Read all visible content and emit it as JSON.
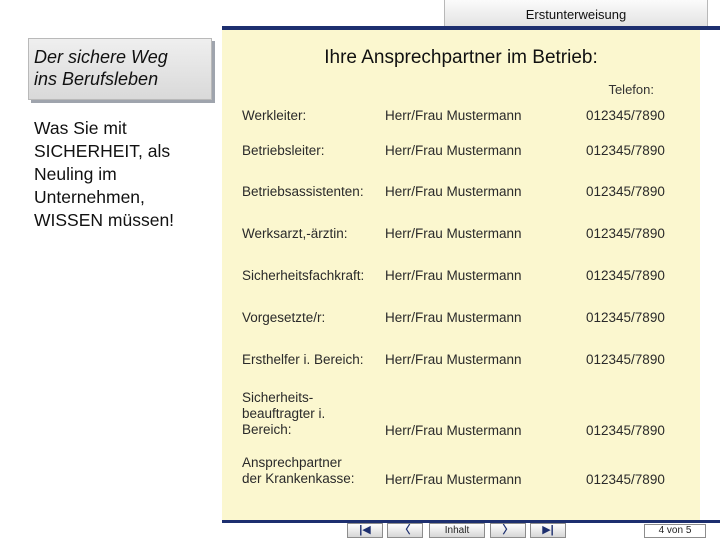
{
  "header": {
    "tab_label": "Erstunterweisung"
  },
  "left": {
    "title_lines": [
      "Der sichere Weg",
      "ins Berufsleben"
    ],
    "body_lines": [
      "Was Sie mit",
      "SICHERHEIT, als",
      "Neuling im",
      "Unternehmen,",
      "WISSEN müssen!"
    ]
  },
  "main": {
    "title": "Ihre Ansprechpartner im Betrieb:",
    "phone_header": "Telefon:",
    "contacts": [
      {
        "role_lines": [
          "Werkleiter:"
        ],
        "name": "Herr/Frau Mustermann",
        "phone": "012345/7890"
      },
      {
        "role_lines": [
          "Betriebsleiter:"
        ],
        "name": "Herr/Frau Mustermann",
        "phone": "012345/7890"
      },
      {
        "role_lines": [
          "Betriebsassistenten:"
        ],
        "name": "Herr/Frau Mustermann",
        "phone": "012345/7890"
      },
      {
        "role_lines": [
          "Werksarzt,-ärztin:"
        ],
        "name": "Herr/Frau Mustermann",
        "phone": "012345/7890"
      },
      {
        "role_lines": [
          "Sicherheitsfachkraft:"
        ],
        "name": "Herr/Frau Mustermann",
        "phone": "012345/7890"
      },
      {
        "role_lines": [
          "Vorgesetzte/r:"
        ],
        "name": "Herr/Frau Mustermann",
        "phone": "012345/7890"
      },
      {
        "role_lines": [
          "Ersthelfer i. Bereich:"
        ],
        "name": "Herr/Frau Mustermann",
        "phone": "012345/7890"
      },
      {
        "role_lines": [
          "Sicherheits-",
          "beauftragter i.",
          "Bereich:"
        ],
        "name": "Herr/Frau Mustermann",
        "phone": "012345/7890"
      },
      {
        "role_lines": [
          "Ansprechpartner",
          "der Krankenkasse:"
        ],
        "name": "Herr/Frau Mustermann",
        "phone": "012345/7890"
      }
    ]
  },
  "nav": {
    "first_icon": "first-page-icon",
    "prev_icon": "previous-page-icon",
    "index_label": "Inhalt",
    "next_icon": "next-page-icon",
    "last_icon": "last-page-icon",
    "page_indicator": "4 von 5"
  },
  "colors": {
    "accent": "#1d2f6f",
    "panel": "#fbf7cf"
  }
}
